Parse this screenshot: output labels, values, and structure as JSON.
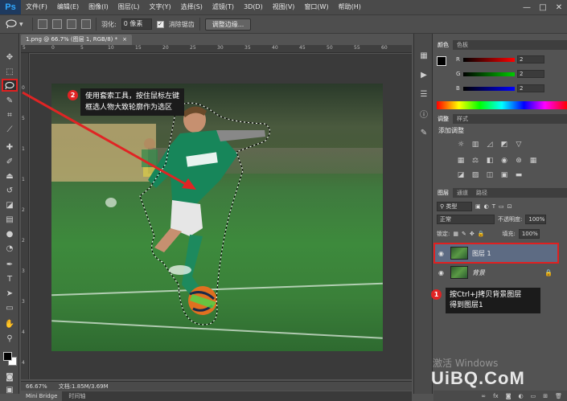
{
  "app": {
    "logo": "Ps",
    "menu": [
      "文件(F)",
      "编辑(E)",
      "图像(I)",
      "图层(L)",
      "文字(Y)",
      "选择(S)",
      "滤镜(T)",
      "3D(D)",
      "视图(V)",
      "窗口(W)",
      "帮助(H)"
    ],
    "window_controls": [
      "—",
      "□",
      "✕"
    ]
  },
  "options_bar": {
    "feather_label": "羽化:",
    "feather_value": "0 像素",
    "antialias_label": "消除锯齿",
    "antialias_checked": true,
    "refine_edge_button": "调整边缘..."
  },
  "document": {
    "tab_title": "1.png @ 66.7% (图层 1, RGB/8) *",
    "tab_close": "×",
    "ruler_h_ticks": [
      "5",
      "0",
      "5",
      "10",
      "15",
      "20",
      "25",
      "30",
      "35",
      "40",
      "45",
      "50",
      "55",
      "60"
    ],
    "ruler_v_ticks": [
      "0",
      "5",
      "1",
      "1",
      "2",
      "2",
      "3",
      "3",
      "4",
      "4"
    ],
    "zoom": "66.67%",
    "doc_info": "文档:1.85M/3.69M"
  },
  "annotations": {
    "step2_number": "2",
    "step2_text_line1": "使用套索工具，按住鼠标左键",
    "step2_text_line2": "框选人物大致轮廓作为选区",
    "step1_number": "1",
    "step1_text_line1": "按Ctrl+J拷贝背景图层",
    "step1_text_line2": "得到图层1",
    "accent_red": "#e02424"
  },
  "bottom_tabs": [
    "Mini Bridge",
    "时间轴"
  ],
  "color_panel": {
    "tabs": [
      "颜色",
      "色板"
    ],
    "channels": [
      {
        "label": "R",
        "value": "2"
      },
      {
        "label": "G",
        "value": "2"
      },
      {
        "label": "B",
        "value": "2"
      }
    ]
  },
  "adjust_panel": {
    "tabs": [
      "调整",
      "样式"
    ],
    "title": "添加调整"
  },
  "layers_panel": {
    "tabs": [
      "图层",
      "通道",
      "路径"
    ],
    "filter_label": "类型",
    "blend_mode": "正常",
    "opacity_label": "不透明度:",
    "opacity_value": "100%",
    "lock_label": "锁定:",
    "fill_label": "填充:",
    "fill_value": "100%",
    "layers": [
      {
        "name": "图层 1",
        "selected": true
      },
      {
        "name": "背景",
        "selected": false
      }
    ],
    "footer_icons": [
      "link-icon",
      "fx-icon",
      "mask-icon",
      "adjust-icon",
      "folder-icon",
      "new-layer-icon",
      "trash-icon"
    ],
    "footer_labels": [
      "∞",
      "fx",
      "◙",
      "◐",
      "▭",
      "⊞",
      "🗑"
    ]
  },
  "watermarks": {
    "activate_windows": "激活 Windows",
    "site": "UiBQ.CoM"
  },
  "tools": [
    "move-icon",
    "marquee-icon",
    "lasso-icon",
    "quick-select-icon",
    "crop-icon",
    "eyedropper-icon",
    "healing-icon",
    "brush-icon",
    "stamp-icon",
    "history-brush-icon",
    "eraser-icon",
    "gradient-icon",
    "blur-icon",
    "dodge-icon",
    "pen-icon",
    "type-icon",
    "path-select-icon",
    "shape-icon",
    "hand-icon",
    "zoom-icon"
  ]
}
